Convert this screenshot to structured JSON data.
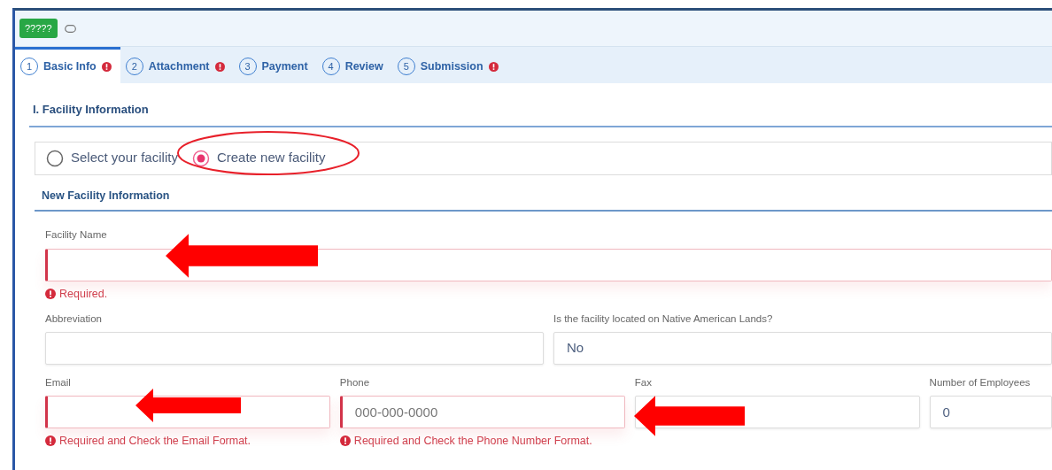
{
  "header": {
    "badge": "?????"
  },
  "tabs": [
    {
      "number": "1",
      "label": "Basic Info",
      "selected": true,
      "error": true
    },
    {
      "number": "2",
      "label": "Attachment",
      "selected": false,
      "error": true
    },
    {
      "number": "3",
      "label": "Payment",
      "selected": false,
      "error": false
    },
    {
      "number": "4",
      "label": "Review",
      "selected": false,
      "error": false
    },
    {
      "number": "5",
      "label": "Submission",
      "selected": false,
      "error": true
    }
  ],
  "section_title": "I. Facility Information",
  "facility_choice": [
    {
      "label": "Select your facility",
      "selected": false
    },
    {
      "label": "Create new facility",
      "selected": true
    }
  ],
  "subsection_title": "New Facility Information",
  "rows": [
    [
      {
        "label": "Facility Name",
        "invalid": true,
        "error": "Required."
      }
    ],
    [
      {
        "label": "Abbreviation",
        "invalid": false
      },
      {
        "label": "Is the facility located on Native American Lands?",
        "value": "No",
        "invalid": false
      }
    ],
    [
      {
        "label": "Email",
        "invalid": true,
        "error": "Required and Check the Email Format."
      },
      {
        "label": "Phone",
        "placeholder": "000-000-0000",
        "invalid": true,
        "error": "Required and Check the Phone Number Format."
      },
      {
        "label": "Fax",
        "invalid": false
      },
      {
        "label": "Number of Employees",
        "value": "0",
        "invalid": false
      }
    ]
  ]
}
